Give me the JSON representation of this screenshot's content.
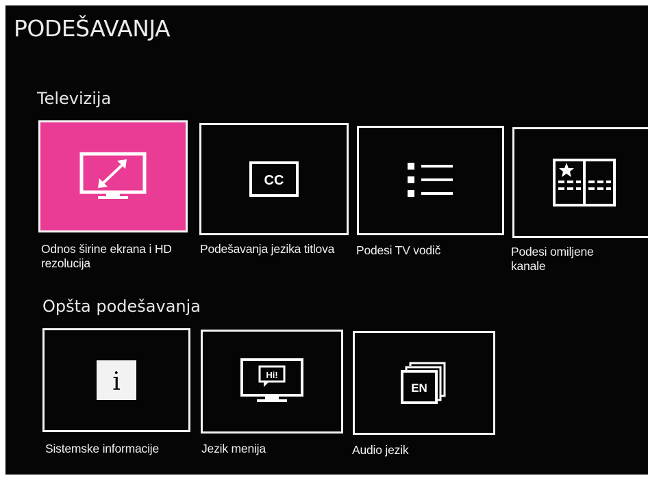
{
  "page": {
    "title": "PODEŠAVANJA"
  },
  "colors": {
    "background": "#050505",
    "accent": "#ea3c94",
    "foreground": "#f2f2f2"
  },
  "sections": [
    {
      "title": "Televizija",
      "tiles": [
        {
          "label": "Odnos širine ekrana i HD rezolucija",
          "icon": "aspect-ratio-tv-icon",
          "selected": true
        },
        {
          "label": "Podešavanja jezika titlova",
          "icon": "cc-icon",
          "icon_text": "CC",
          "selected": false
        },
        {
          "label": "Podesi TV vodič",
          "icon": "list-icon",
          "selected": false
        },
        {
          "label": "Podesi omiljene kanale",
          "icon": "favorite-channels-icon",
          "selected": false
        }
      ]
    },
    {
      "title": "Opšta podešavanja",
      "tiles": [
        {
          "label": "Sistemske informacije",
          "icon": "info-icon",
          "icon_text": "i",
          "selected": false
        },
        {
          "label": "Jezik menija",
          "icon": "menu-language-icon",
          "icon_text": "Hi!",
          "selected": false
        },
        {
          "label": "Audio jezik",
          "icon": "audio-language-icon",
          "icon_text": "EN",
          "selected": false
        }
      ]
    }
  ]
}
